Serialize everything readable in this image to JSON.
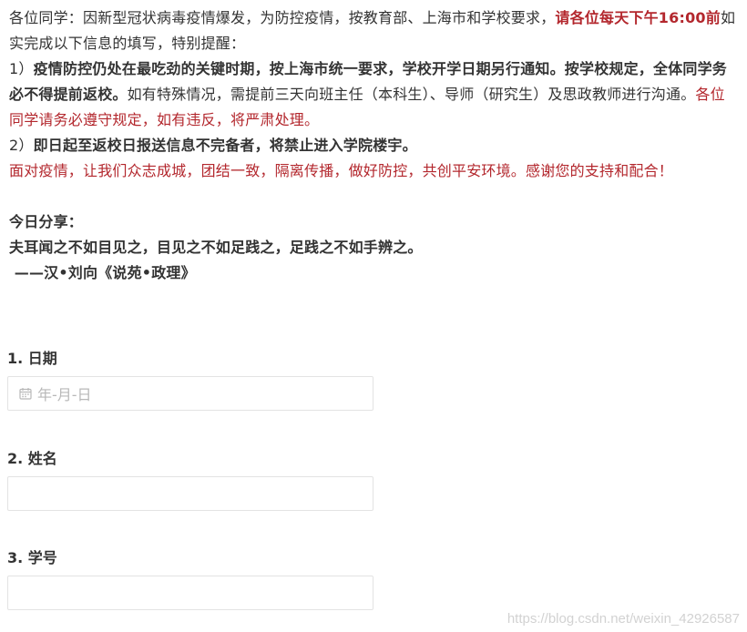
{
  "notice": {
    "intro_1": "各位同学：因新型冠状病毒疫情爆发，为防控疫情，按教育部、上海市和学校要求，",
    "intro_red": "请各位每天下午16:00前",
    "intro_2": "如实完成以下信息的填写，特别提醒：",
    "item1_prefix": "1）",
    "item1_bold": "疫情防控仍处在最吃劲的关键时期，按上海市统一要求，学校开学日期另行通知。按学校规定，全体同学务必不得提前返校。",
    "item1_text": "如有特殊情况，需提前三天向班主任（本科生）、导师（研究生）及思政教师进行沟通。",
    "item1_red": "各位同学请务必遵守规定，如有违反，将严肃处理。",
    "item2_prefix": "2）",
    "item2_bold": "即日起至返校日报送信息不完备者，将禁止进入学院楼宇。",
    "closing_red": "面对疫情，让我们众志成城，团结一致，隔离传播，做好防控，共创平安环境。感谢您的支持和配合！",
    "share_title": "今日分享：",
    "share_quote": "夫耳闻之不如目见之，目见之不如足践之，足践之不如手辨之。",
    "share_source": " ——汉•刘向《说苑•政理》"
  },
  "questions": [
    {
      "label": "1. 日期",
      "placeholder": "年-月-日",
      "icon": "calendar-icon"
    },
    {
      "label": "2. 姓名",
      "value": ""
    },
    {
      "label": "3. 学号",
      "value": ""
    }
  ],
  "watermark": "https://blog.csdn.net/weixin_42926587",
  "colors": {
    "red_text": "#b3272d",
    "body_text": "#333333",
    "placeholder": "#b8b8b8",
    "input_border": "#e3e3e3"
  }
}
